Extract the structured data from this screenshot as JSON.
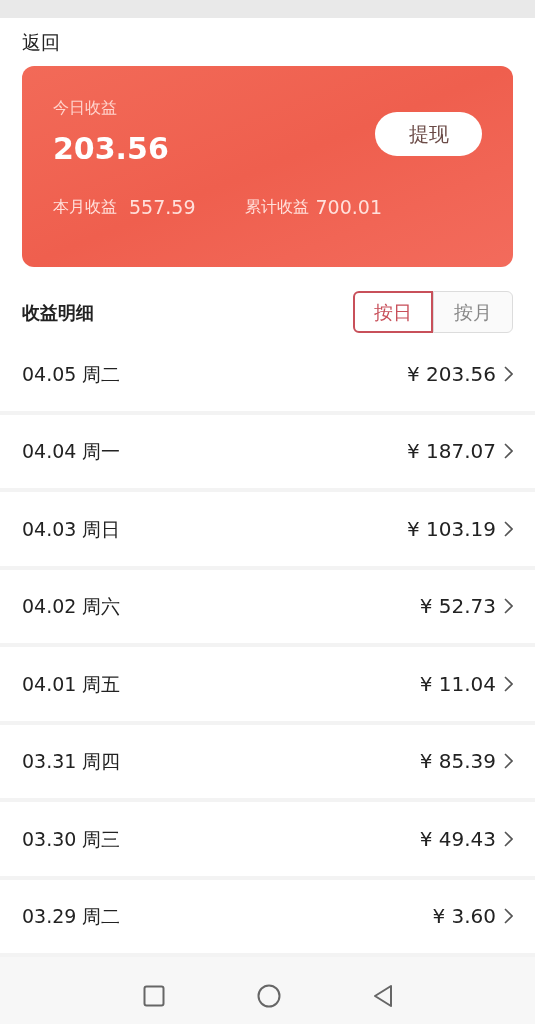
{
  "header": {
    "back": "返回"
  },
  "card": {
    "today_label": "今日收益",
    "today_value": "203.56",
    "withdraw_button": "提现",
    "month_label": "本月收益",
    "month_value": "557.59",
    "total_label": "累计收益",
    "total_value": "700.01"
  },
  "details": {
    "title": "收益明细",
    "toggle": [
      {
        "label": "按日",
        "selected": true
      },
      {
        "label": "按月",
        "selected": false
      }
    ]
  },
  "rows": [
    {
      "date": "04.05 周二",
      "amount": "¥ 203.56"
    },
    {
      "date": "04.04 周一",
      "amount": "¥ 187.07"
    },
    {
      "date": "04.03 周日",
      "amount": "¥ 103.19"
    },
    {
      "date": "04.02 周六",
      "amount": "¥ 52.73"
    },
    {
      "date": "04.01 周五",
      "amount": "¥ 11.04"
    },
    {
      "date": "03.31 周四",
      "amount": "¥ 85.39"
    },
    {
      "date": "03.30 周三",
      "amount": "¥ 49.43"
    },
    {
      "date": "03.29 周二",
      "amount": "¥ 3.60"
    }
  ]
}
